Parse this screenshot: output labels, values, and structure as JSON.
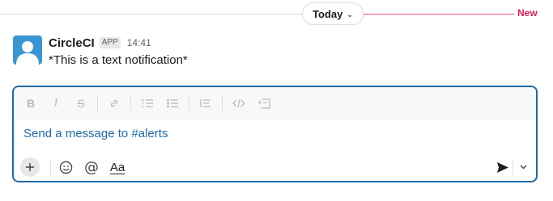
{
  "divider": {
    "day_label": "Today",
    "new_label": "New",
    "new_color": "#e01e5a",
    "chevron_icon": "chevron-down-icon"
  },
  "message": {
    "sender": "CircleCI",
    "badge": "APP",
    "time": "14:41",
    "text": "*This is a text notification*",
    "avatar_color": "#3a95d3"
  },
  "composer": {
    "placeholder": "Send a message to #alerts",
    "accent_color": "#1d6aa8",
    "toolbar_icons": [
      "bold-icon",
      "italic-icon",
      "strikethrough-icon",
      "link-icon",
      "ordered-list-icon",
      "bulleted-list-icon",
      "blockquote-icon",
      "code-icon",
      "code-block-icon"
    ],
    "format_label": "Aa",
    "mention_label": "@",
    "bottom_icons": [
      "plus-icon",
      "emoji-icon",
      "mention-icon",
      "text-format-icon",
      "send-icon",
      "chevron-down-icon"
    ]
  }
}
